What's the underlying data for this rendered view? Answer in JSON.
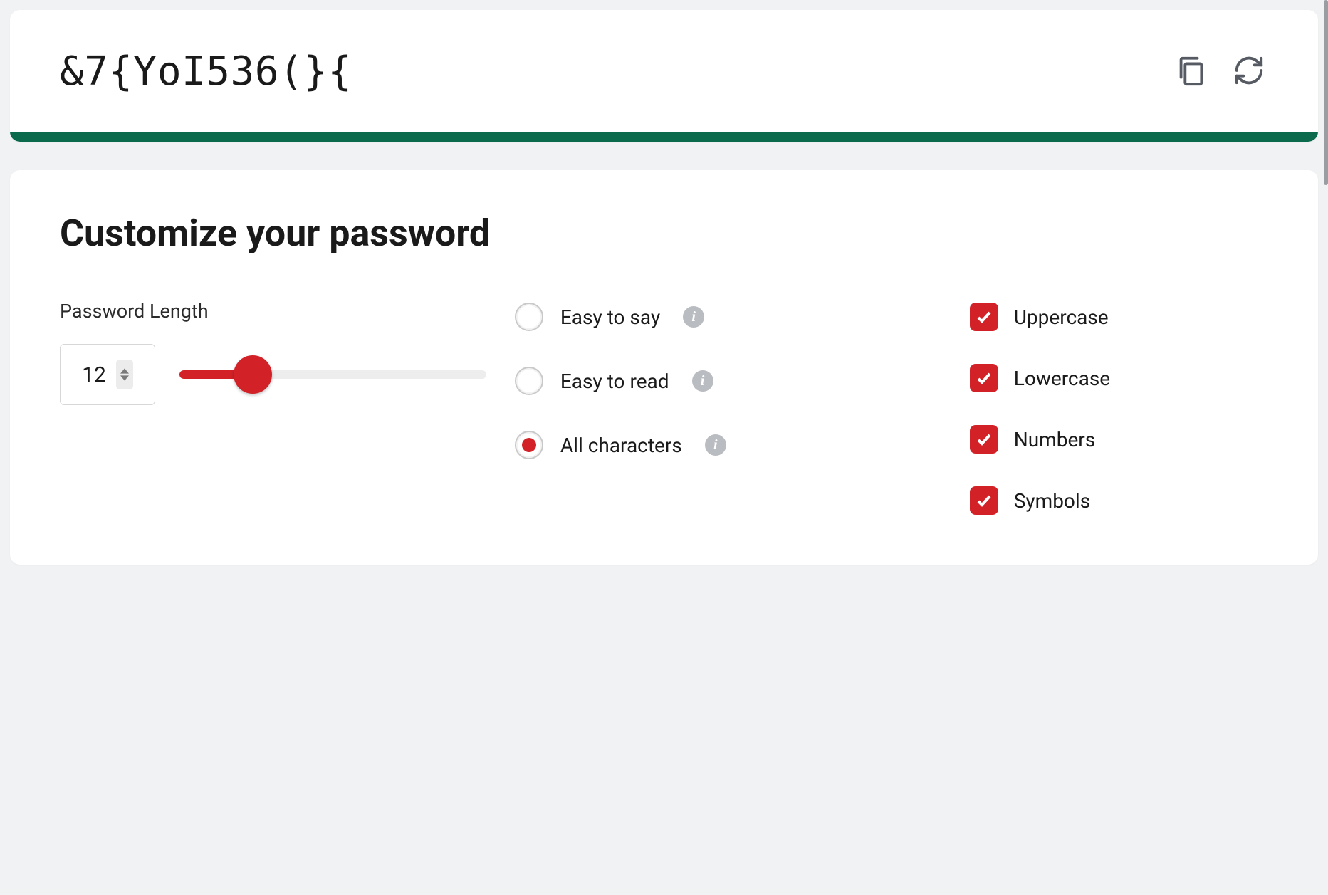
{
  "password": {
    "value": "&7{YoI536(}{",
    "strength_color": "#0b6a4b"
  },
  "customize": {
    "title": "Customize your password",
    "length_label": "Password Length",
    "length_value": "12",
    "slider": {
      "min": 1,
      "max": 50,
      "value": 12
    },
    "radios": [
      {
        "label": "Easy to say",
        "checked": false,
        "has_info": true
      },
      {
        "label": "Easy to read",
        "checked": false,
        "has_info": true
      },
      {
        "label": "All characters",
        "checked": true,
        "has_info": true
      }
    ],
    "checks": [
      {
        "label": "Uppercase",
        "checked": true
      },
      {
        "label": "Lowercase",
        "checked": true
      },
      {
        "label": "Numbers",
        "checked": true
      },
      {
        "label": "Symbols",
        "checked": true
      }
    ]
  }
}
